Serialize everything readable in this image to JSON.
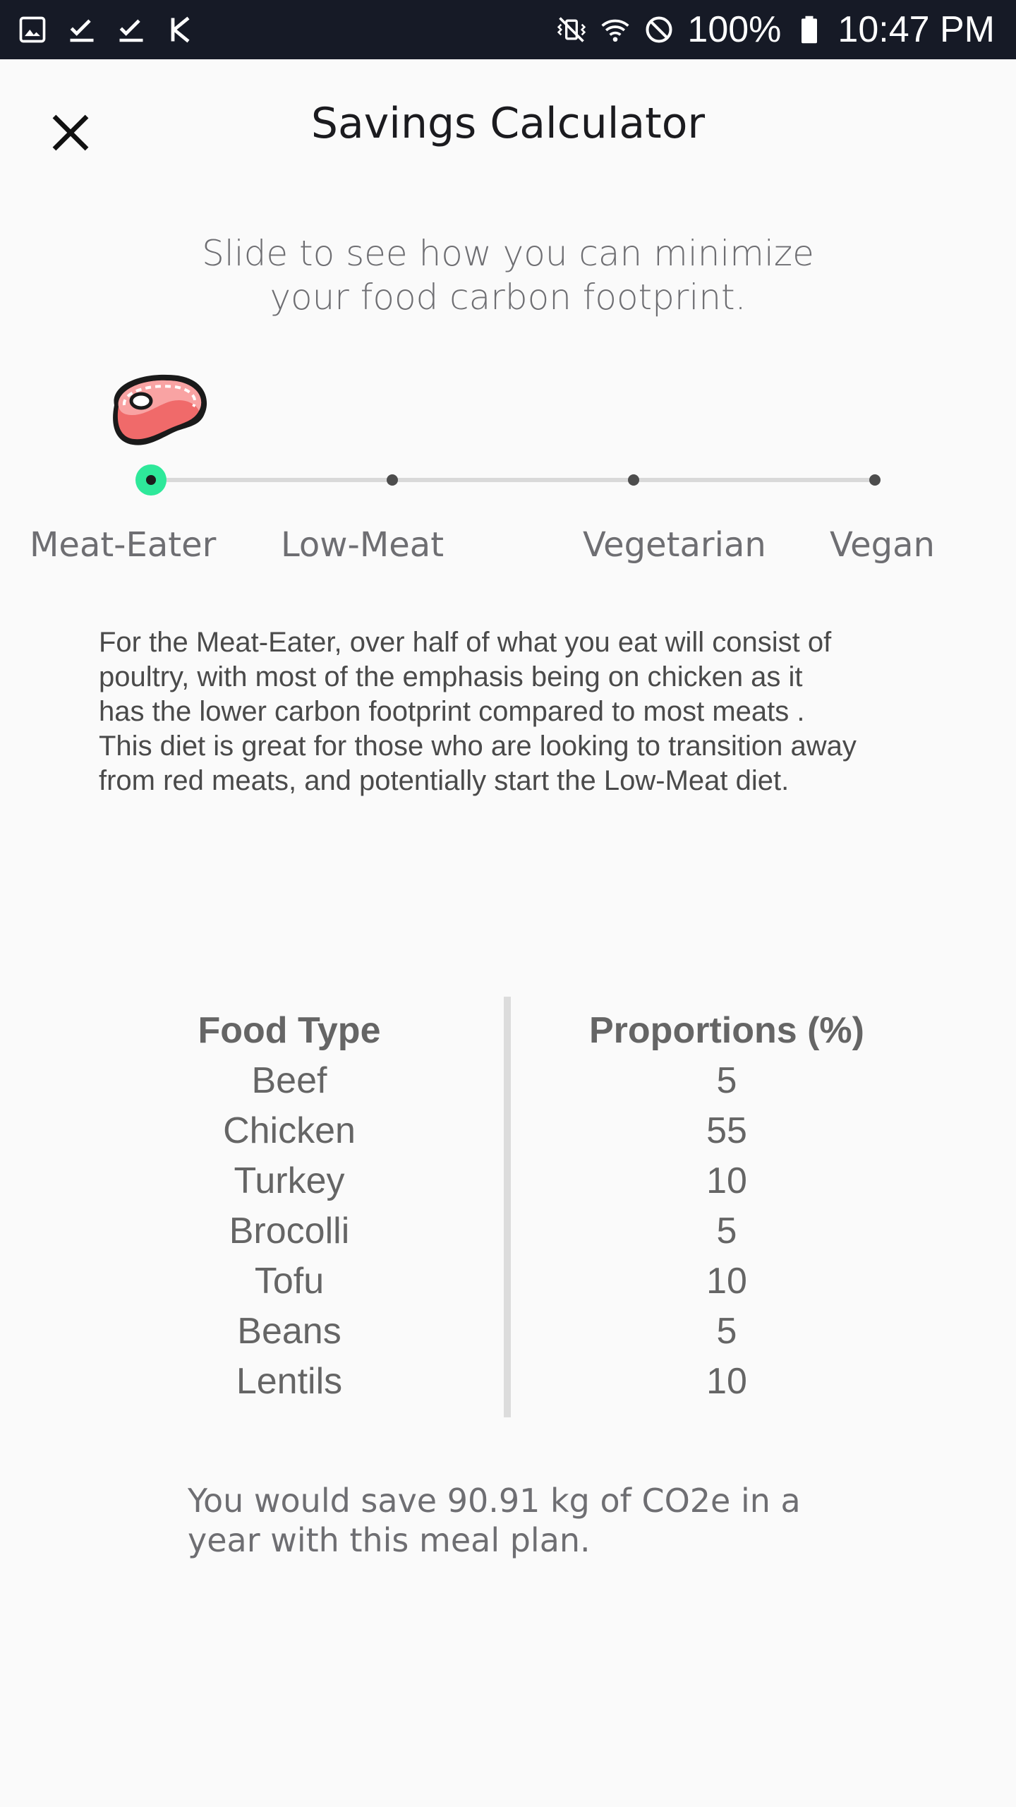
{
  "status_bar": {
    "left_icons": [
      "image-icon",
      "check-icon",
      "check-icon",
      "k-icon"
    ],
    "right_icons": [
      "vibrate-mute-icon",
      "wifi-icon",
      "do-not-disturb-icon"
    ],
    "battery": "100%",
    "time": "10:47 PM"
  },
  "header": {
    "close_icon": "close-icon",
    "title": "Savings Calculator"
  },
  "subtitle": {
    "line1": "Slide to see how you can minimize",
    "line2": "your food carbon footprint."
  },
  "slider": {
    "selected_icon": "steak-icon",
    "selected": "Meat-Eater",
    "accent_color": "#2ee89a",
    "options": [
      "Meat-Eater",
      "Low-Meat",
      "Vegetarian",
      "Vegan"
    ]
  },
  "description": {
    "lines": [
      "For the Meat-Eater, over half of what you eat will consist of",
      "poultry, with most of the emphasis being on chicken as it",
      "has the lower carbon footprint compared to most meats .",
      "This diet is great for those who are looking to transition away",
      "from red meats, and potentially start the Low-Meat diet."
    ]
  },
  "table": {
    "headers": [
      "Food Type",
      "Proportions (%)"
    ],
    "rows": [
      {
        "food": "Beef",
        "proportion": "5"
      },
      {
        "food": "Chicken",
        "proportion": "55"
      },
      {
        "food": "Turkey",
        "proportion": "10"
      },
      {
        "food": "Brocolli",
        "proportion": "5"
      },
      {
        "food": "Tofu",
        "proportion": "10"
      },
      {
        "food": "Beans",
        "proportion": "5"
      },
      {
        "food": "Lentils",
        "proportion": "10"
      }
    ]
  },
  "savings": {
    "line1": "You would save 90.91 kg of CO2e in a",
    "line2": "year with this meal plan."
  }
}
